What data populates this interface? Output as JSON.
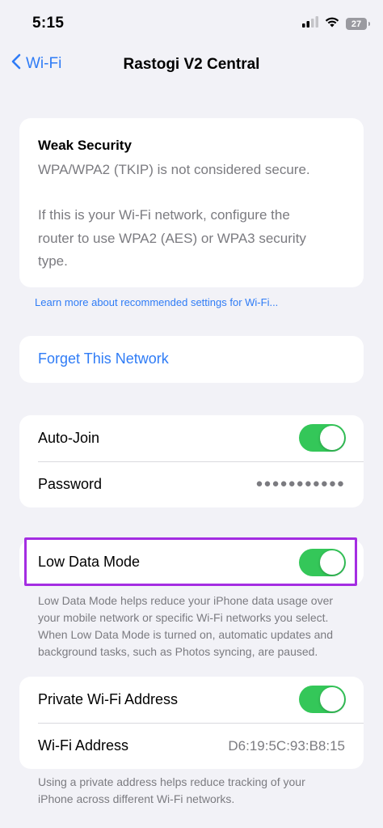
{
  "status_bar": {
    "time": "5:15",
    "battery_level": "27"
  },
  "nav": {
    "back_label": "Wi-Fi",
    "title": "Rastogi V2 Central"
  },
  "weak_security": {
    "title": "Weak Security",
    "lines": [
      "WPA/WPA2 (TKIP) is not considered secure.",
      "If this is your Wi-Fi network, configure the",
      "router to use WPA2 (AES) or WPA3 security",
      "type."
    ]
  },
  "learn_more_link": "Learn more about recommended settings for Wi-Fi...",
  "forget_network": "Forget This Network",
  "auto_join": {
    "label": "Auto-Join",
    "enabled": true
  },
  "password": {
    "label": "Password",
    "value": "●●●●●●●●●●●"
  },
  "low_data_mode": {
    "label": "Low Data Mode",
    "enabled": true,
    "description_lines": [
      "Low Data Mode helps reduce your iPhone data usage over",
      "your mobile network or specific Wi-Fi networks you select.",
      "When Low Data Mode is turned on, automatic updates and",
      "background tasks, such as Photos syncing, are paused."
    ]
  },
  "private_address": {
    "label": "Private Wi-Fi Address",
    "enabled": true
  },
  "wifi_address": {
    "label": "Wi-Fi Address",
    "value": "D6:19:5C:93:B8:15"
  },
  "private_description_lines": [
    "Using a private address helps reduce tracking of your",
    "iPhone across different Wi-Fi networks."
  ],
  "colors": {
    "accent_blue": "#2f7cf6",
    "toggle_green": "#34c759",
    "highlight_purple": "#a42de2",
    "background": "#f2f2f7"
  },
  "icons": [
    "cellular-signal-icon",
    "wifi-icon",
    "battery-icon",
    "chevron-left-icon"
  ]
}
